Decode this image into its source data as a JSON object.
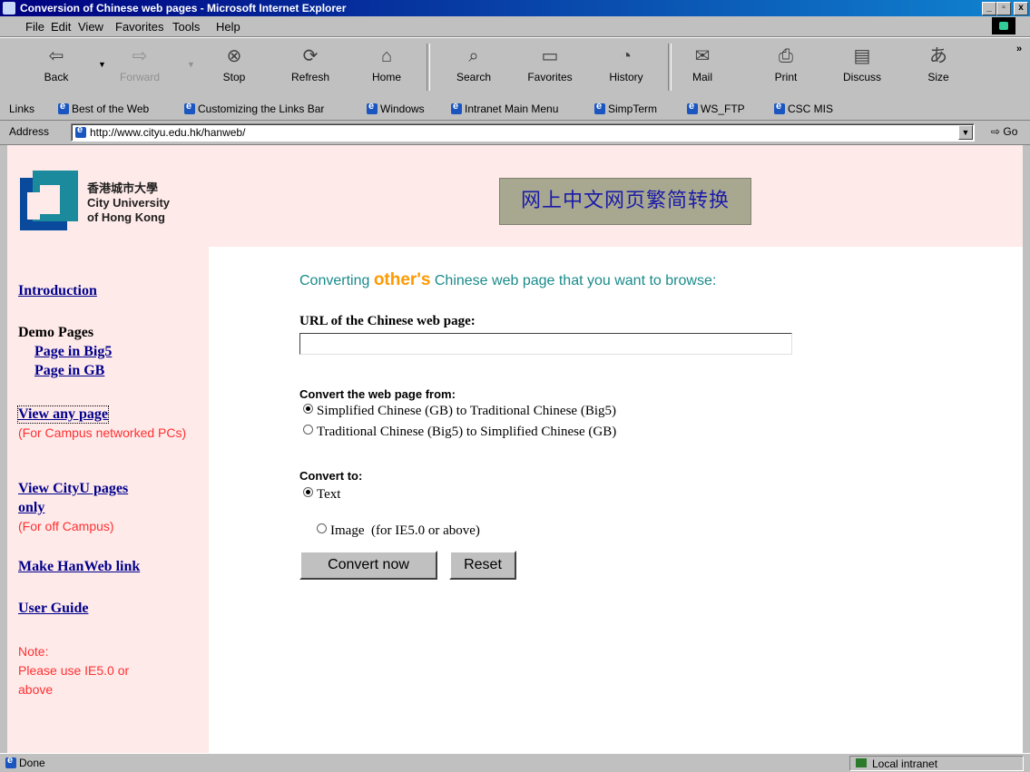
{
  "window": {
    "title": "Conversion of Chinese web pages - Microsoft Internet Explorer",
    "min_glyph": "_",
    "max_glyph": "▫",
    "close_glyph": "x"
  },
  "menu": [
    "File",
    "Edit",
    "View",
    "Favorites",
    "Tools",
    "Help"
  ],
  "toolbar": {
    "back": "Back",
    "forward": "Forward",
    "stop": "Stop",
    "refresh": "Refresh",
    "home": "Home",
    "search": "Search",
    "favorites": "Favorites",
    "history": "History",
    "mail": "Mail",
    "print": "Print",
    "discuss": "Discuss",
    "size": "Size",
    "more": "»"
  },
  "links": {
    "label": "Links",
    "items": [
      "Best of the Web",
      "Customizing the Links Bar",
      "Windows",
      "Intranet Main Menu",
      "SimpTerm",
      "WS_FTP",
      "CSC MIS"
    ]
  },
  "address": {
    "label": "Address",
    "url": "http://www.cityu.edu.hk/hanweb/",
    "go": "Go"
  },
  "logo": {
    "line1": "香港城市大學",
    "line2": "City University",
    "line3": "of Hong Kong"
  },
  "banner": "网上中文网页繁简转换",
  "sidebar": {
    "introduction": "Introduction",
    "demo_heading": "Demo Pages",
    "demo_big5": "Page in Big5",
    "demo_gb": "Page in GB",
    "view_any": "View any page",
    "view_any_note": "(For Campus networked PCs)",
    "view_cityu_1": "View CityU pages",
    "view_cityu_2": "only",
    "view_cityu_note": "(For off Campus)",
    "make_link": "Make HanWeb link",
    "user_guide": "User Guide",
    "note_1": "Note:",
    "note_2": "Please use IE5.0 or",
    "note_3": "above"
  },
  "main": {
    "heading_pre": "Converting ",
    "heading_accent": "other's",
    "heading_post": " Chinese web page that you want to browse:",
    "url_label": "URL of the Chinese web page:",
    "url_value": "",
    "from_label": "Convert the web page from:",
    "from_options": [
      {
        "label": "Simplified Chinese (GB) to Traditional Chinese (Big5)",
        "selected": true
      },
      {
        "label": "Traditional Chinese (Big5) to Simplified Chinese (GB)",
        "selected": false
      }
    ],
    "to_label": "Convert to:",
    "to_options": [
      {
        "label": "Text",
        "selected": true
      },
      {
        "label": "Image  (for IE5.0 or above)",
        "selected": false
      }
    ],
    "convert_button": "Convert now",
    "reset_button": "Reset"
  },
  "status": {
    "text": "Done",
    "zone": "Local intranet"
  }
}
